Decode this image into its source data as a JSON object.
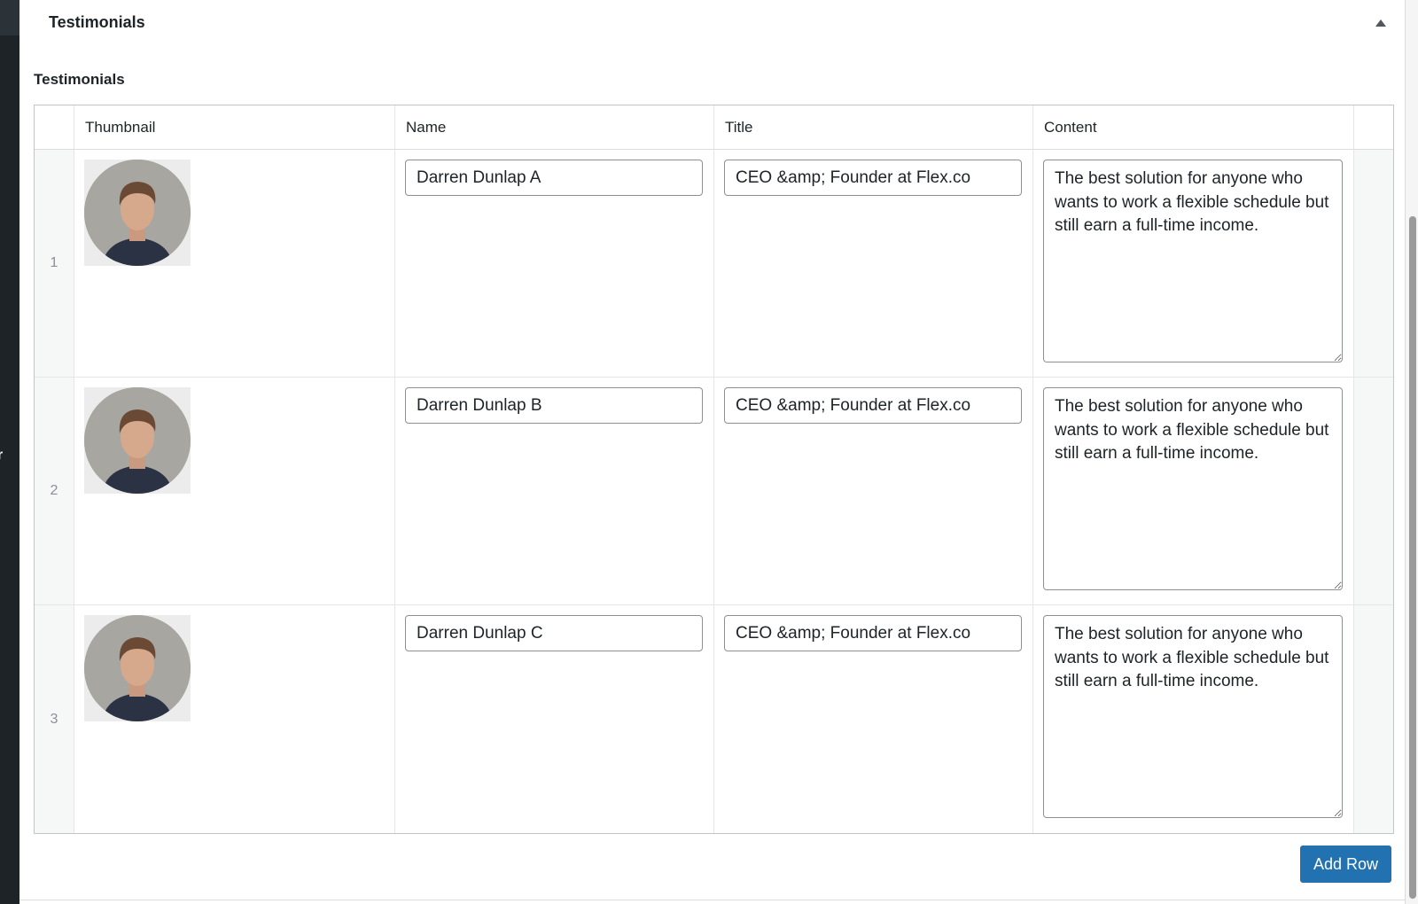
{
  "panel": {
    "title": "Testimonials",
    "toggle_icon": "triangle-up-icon"
  },
  "field": {
    "label": "Testimonials"
  },
  "sidebar": {
    "clipped_text": "r"
  },
  "repeater": {
    "columns": {
      "thumbnail": "Thumbnail",
      "name": "Name",
      "title": "Title",
      "content": "Content"
    },
    "rows": [
      {
        "index": "1",
        "name": "Darren Dunlap A",
        "title": "CEO &amp; Founder at Flex.co",
        "content": "The best solution for anyone who wants to work a flexible schedule but still earn a full-time income."
      },
      {
        "index": "2",
        "name": "Darren Dunlap B",
        "title": "CEO &amp; Founder at Flex.co",
        "content": "The best solution for anyone who wants to work a flexible schedule but still earn a full-time income."
      },
      {
        "index": "3",
        "name": "Darren Dunlap C",
        "title": "CEO &amp; Founder at Flex.co",
        "content": "The best solution for anyone who wants to work a flexible schedule but still earn a full-time income."
      }
    ]
  },
  "actions": {
    "add_row_label": "Add Row"
  },
  "colors": {
    "primary_button": "#2271b1",
    "sidebar": "#1d2327"
  }
}
